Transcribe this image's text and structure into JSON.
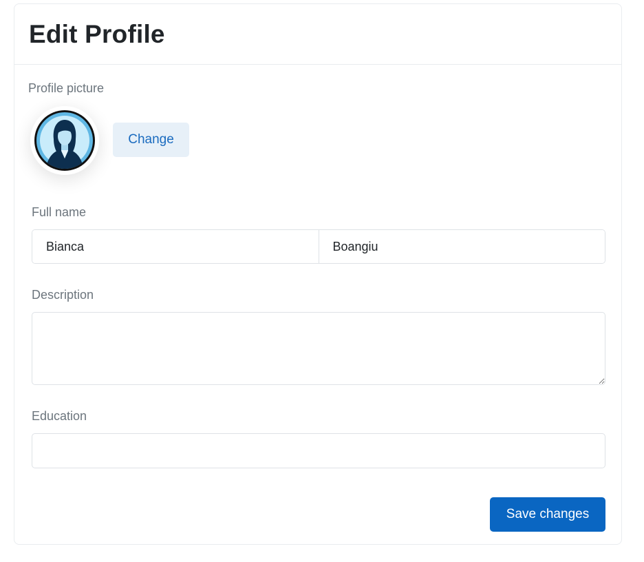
{
  "header": {
    "title": "Edit Profile"
  },
  "profile_picture": {
    "label": "Profile picture",
    "avatar_icon": "woman-avatar-icon",
    "change_label": "Change"
  },
  "full_name": {
    "label": "Full name",
    "first_value": "Bianca",
    "last_value": "Boangiu"
  },
  "description": {
    "label": "Description",
    "value": ""
  },
  "education": {
    "label": "Education",
    "value": ""
  },
  "actions": {
    "save_label": "Save changes"
  },
  "colors": {
    "primary": "#0a66c2",
    "secondary_bg": "#e7f0f8",
    "label_text": "#6c757d",
    "border": "#dee2e6"
  }
}
